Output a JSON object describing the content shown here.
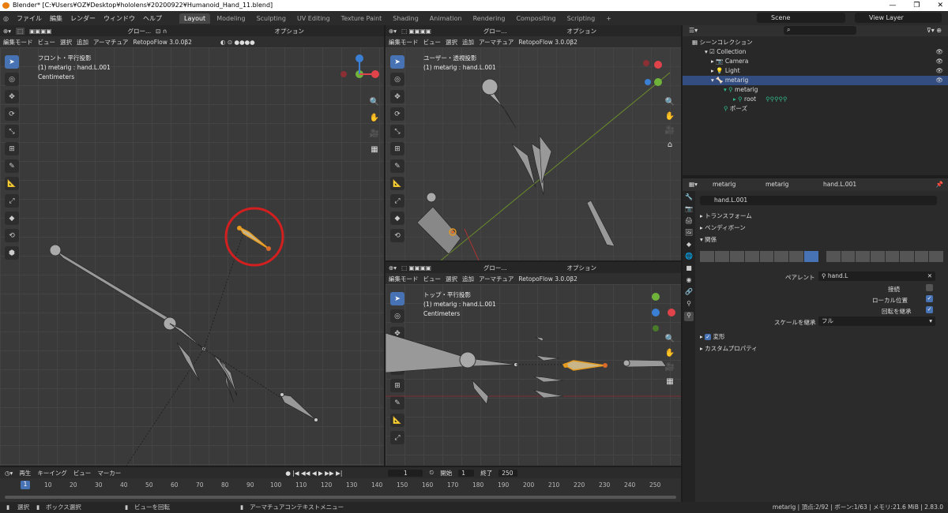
{
  "window": {
    "title": "Blender* [C:¥Users¥OZ¥Desktop¥hololens¥20200922¥Humanoid_Hand_11.blend]",
    "minimize": "—",
    "maximize": "❐",
    "close": "✕"
  },
  "menu": [
    "ファイル",
    "編集",
    "レンダー",
    "ウィンドウ",
    "ヘルプ"
  ],
  "workspaces": [
    "Layout",
    "Modeling",
    "Sculpting",
    "UV Editing",
    "Texture Paint",
    "Shading",
    "Animation",
    "Rendering",
    "Compositing",
    "Scripting"
  ],
  "active_workspace": "Layout",
  "scene": {
    "name": "Scene",
    "view_layer": "View Layer"
  },
  "vp_common": {
    "mode": "編集モード",
    "view": "ビュー",
    "select": "選択",
    "add": "追加",
    "armature": "アーマチュア",
    "addon": "RetopoFlow 3.0.0β2",
    "global": "グロー...",
    "options": "オプション"
  },
  "vp_left": {
    "view_name": "フロント・平行投影",
    "object": "(1) metarig : hand.L.001",
    "units": "Centimeters"
  },
  "vp_tr": {
    "view_name": "ユーザー・透視投影",
    "object": "(1) metarig : hand.L.001"
  },
  "vp_br": {
    "view_name": "トップ・平行投影",
    "object": "(1) metarig : hand.L.001",
    "units": "Centimeters"
  },
  "outliner": {
    "search": "",
    "header": "シーンコレクション",
    "items": [
      "Collection",
      "Camera",
      "Light",
      "metarig",
      "metarig",
      "root",
      "ポーズ"
    ]
  },
  "props": {
    "tabs": [
      "metarig",
      "metarig",
      "hand.L.001"
    ],
    "bone_name": "hand.L.001",
    "sections": [
      "トランスフォーム",
      "ベンディボーン",
      "関係"
    ],
    "parent_label": "ペアレント",
    "parent_value": "hand.L",
    "connect_label": "接続",
    "local_loc_label": "ローカル位置",
    "inherit_rot_label": "回転を継承",
    "inherit_scale_label": "スケールを継承",
    "inherit_scale_value": "フル",
    "deform": "変形",
    "custom": "カスタムプロパティ"
  },
  "timeline": {
    "playback": "再生",
    "keying": "キーイング",
    "view": "ビュー",
    "marker": "マーカー",
    "current": "1",
    "start_label": "開始",
    "start": "1",
    "end_label": "終了",
    "end": "250",
    "ticks": [
      "1",
      "10",
      "20",
      "30",
      "40",
      "50",
      "60",
      "70",
      "80",
      "90",
      "100",
      "110",
      "120",
      "130",
      "140",
      "150",
      "160",
      "170",
      "180",
      "190",
      "200",
      "210",
      "220",
      "230",
      "240",
      "250"
    ]
  },
  "status": {
    "select": "選択",
    "box": "ボックス選択",
    "rotate": "ビューを回転",
    "context": "アーマチュアコンテキストメニュー",
    "info": "metarig | 頂点:2/92 | ボーン:1/63 | メモリ:21.6 MiB | 2.83.0"
  }
}
